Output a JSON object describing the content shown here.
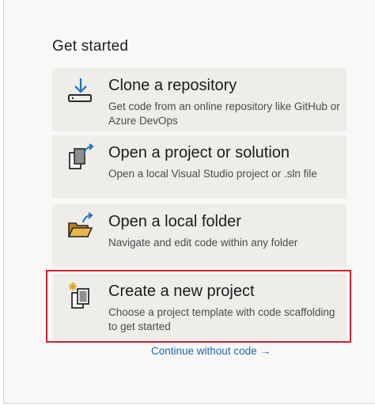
{
  "heading": "Get started",
  "cards": [
    {
      "title": "Clone a repository",
      "description": "Get code from an online repository like GitHub or Azure DevOps",
      "icon": "clone-download-icon"
    },
    {
      "title": "Open a project or solution",
      "description": "Open a local Visual Studio project or .sln file",
      "icon": "open-project-icon"
    },
    {
      "title": "Open a local folder",
      "description": "Navigate and edit code within any folder",
      "icon": "open-folder-icon"
    },
    {
      "title": "Create a new project",
      "description": "Choose a project template with code scaffolding to get started",
      "icon": "new-project-icon"
    }
  ],
  "continue_link": {
    "label": "Continue without code",
    "arrow": "→"
  },
  "colors": {
    "card_background": "#efedea",
    "highlight_border": "#d1202a",
    "link": "#1a66b3",
    "folder_accent": "#d9a42a",
    "icon_blue": "#1f6fc2"
  }
}
